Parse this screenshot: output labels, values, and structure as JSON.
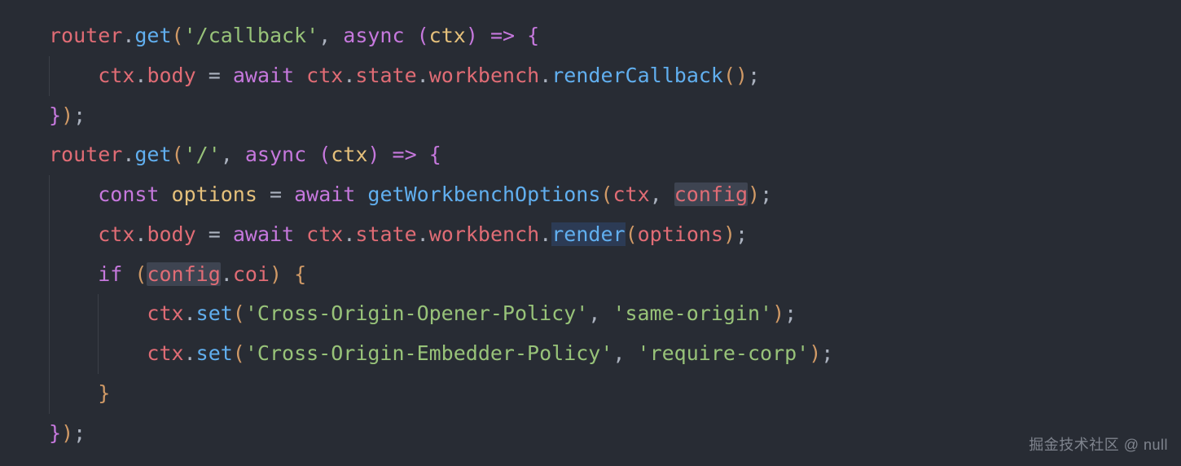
{
  "code": {
    "lines": [
      {
        "tokens": [
          {
            "t": "router",
            "c": "tok-var"
          },
          {
            "t": ".",
            "c": "tok-punct"
          },
          {
            "t": "get",
            "c": "tok-method"
          },
          {
            "t": "(",
            "c": "tok-paren"
          },
          {
            "t": "'/callback'",
            "c": "tok-string"
          },
          {
            "t": ", ",
            "c": "tok-punct"
          },
          {
            "t": "async",
            "c": "tok-keyword"
          },
          {
            "t": " ",
            "c": "tok-punct"
          },
          {
            "t": "(",
            "c": "tok-paren2"
          },
          {
            "t": "ctx",
            "c": "tok-param"
          },
          {
            "t": ")",
            "c": "tok-paren2"
          },
          {
            "t": " ",
            "c": "tok-punct"
          },
          {
            "t": "=>",
            "c": "tok-keyword"
          },
          {
            "t": " ",
            "c": "tok-punct"
          },
          {
            "t": "{",
            "c": "tok-brace2"
          }
        ],
        "indent": 0
      },
      {
        "tokens": [
          {
            "t": "    ",
            "c": "tok-punct"
          },
          {
            "t": "ctx",
            "c": "tok-var"
          },
          {
            "t": ".",
            "c": "tok-punct"
          },
          {
            "t": "body",
            "c": "tok-prop"
          },
          {
            "t": " ",
            "c": "tok-punct"
          },
          {
            "t": "=",
            "c": "tok-punct"
          },
          {
            "t": " ",
            "c": "tok-punct"
          },
          {
            "t": "await",
            "c": "tok-keyword"
          },
          {
            "t": " ",
            "c": "tok-punct"
          },
          {
            "t": "ctx",
            "c": "tok-var"
          },
          {
            "t": ".",
            "c": "tok-punct"
          },
          {
            "t": "state",
            "c": "tok-prop"
          },
          {
            "t": ".",
            "c": "tok-punct"
          },
          {
            "t": "workbench",
            "c": "tok-prop"
          },
          {
            "t": ".",
            "c": "tok-punct"
          },
          {
            "t": "renderCallback",
            "c": "tok-method"
          },
          {
            "t": "(",
            "c": "tok-paren"
          },
          {
            "t": ")",
            "c": "tok-paren"
          },
          {
            "t": ";",
            "c": "tok-punct"
          }
        ],
        "indent": 1
      },
      {
        "tokens": [
          {
            "t": "}",
            "c": "tok-brace2"
          },
          {
            "t": ")",
            "c": "tok-paren"
          },
          {
            "t": ";",
            "c": "tok-punct"
          }
        ],
        "indent": 0
      },
      {
        "tokens": [
          {
            "t": "router",
            "c": "tok-var"
          },
          {
            "t": ".",
            "c": "tok-punct"
          },
          {
            "t": "get",
            "c": "tok-method"
          },
          {
            "t": "(",
            "c": "tok-paren"
          },
          {
            "t": "'/'",
            "c": "tok-string"
          },
          {
            "t": ", ",
            "c": "tok-punct"
          },
          {
            "t": "async",
            "c": "tok-keyword"
          },
          {
            "t": " ",
            "c": "tok-punct"
          },
          {
            "t": "(",
            "c": "tok-paren2"
          },
          {
            "t": "ctx",
            "c": "tok-param"
          },
          {
            "t": ")",
            "c": "tok-paren2"
          },
          {
            "t": " ",
            "c": "tok-punct"
          },
          {
            "t": "=>",
            "c": "tok-keyword"
          },
          {
            "t": " ",
            "c": "tok-punct"
          },
          {
            "t": "{",
            "c": "tok-brace2"
          }
        ],
        "indent": 0
      },
      {
        "tokens": [
          {
            "t": "    ",
            "c": "tok-punct"
          },
          {
            "t": "const",
            "c": "tok-keyword"
          },
          {
            "t": " ",
            "c": "tok-punct"
          },
          {
            "t": "options",
            "c": "tok-const"
          },
          {
            "t": " ",
            "c": "tok-punct"
          },
          {
            "t": "=",
            "c": "tok-punct"
          },
          {
            "t": " ",
            "c": "tok-punct"
          },
          {
            "t": "await",
            "c": "tok-keyword"
          },
          {
            "t": " ",
            "c": "tok-punct"
          },
          {
            "t": "getWorkbenchOptions",
            "c": "tok-func"
          },
          {
            "t": "(",
            "c": "tok-paren"
          },
          {
            "t": "ctx",
            "c": "tok-var"
          },
          {
            "t": ", ",
            "c": "tok-punct"
          },
          {
            "t": "config",
            "c": "tok-var",
            "hl": "occ"
          },
          {
            "t": ")",
            "c": "tok-paren"
          },
          {
            "t": ";",
            "c": "tok-punct"
          }
        ],
        "indent": 1
      },
      {
        "tokens": [
          {
            "t": "    ",
            "c": "tok-punct"
          },
          {
            "t": "ctx",
            "c": "tok-var"
          },
          {
            "t": ".",
            "c": "tok-punct"
          },
          {
            "t": "body",
            "c": "tok-prop"
          },
          {
            "t": " ",
            "c": "tok-punct"
          },
          {
            "t": "=",
            "c": "tok-punct"
          },
          {
            "t": " ",
            "c": "tok-punct"
          },
          {
            "t": "await",
            "c": "tok-keyword"
          },
          {
            "t": " ",
            "c": "tok-punct"
          },
          {
            "t": "ctx",
            "c": "tok-var"
          },
          {
            "t": ".",
            "c": "tok-punct"
          },
          {
            "t": "state",
            "c": "tok-prop"
          },
          {
            "t": ".",
            "c": "tok-punct"
          },
          {
            "t": "workbench",
            "c": "tok-prop"
          },
          {
            "t": ".",
            "c": "tok-punct"
          },
          {
            "t": "render",
            "c": "tok-method",
            "hl": "sel"
          },
          {
            "t": "(",
            "c": "tok-paren"
          },
          {
            "t": "options",
            "c": "tok-var"
          },
          {
            "t": ")",
            "c": "tok-paren"
          },
          {
            "t": ";",
            "c": "tok-punct"
          }
        ],
        "indent": 1
      },
      {
        "tokens": [
          {
            "t": "    ",
            "c": "tok-punct"
          },
          {
            "t": "if",
            "c": "tok-keyword"
          },
          {
            "t": " ",
            "c": "tok-punct"
          },
          {
            "t": "(",
            "c": "tok-paren"
          },
          {
            "t": "config",
            "c": "tok-var",
            "hl": "occ"
          },
          {
            "t": ".",
            "c": "tok-punct"
          },
          {
            "t": "coi",
            "c": "tok-prop"
          },
          {
            "t": ")",
            "c": "tok-paren"
          },
          {
            "t": " ",
            "c": "tok-punct"
          },
          {
            "t": "{",
            "c": "tok-brace"
          }
        ],
        "indent": 1
      },
      {
        "tokens": [
          {
            "t": "        ",
            "c": "tok-punct"
          },
          {
            "t": "ctx",
            "c": "tok-var"
          },
          {
            "t": ".",
            "c": "tok-punct"
          },
          {
            "t": "set",
            "c": "tok-method"
          },
          {
            "t": "(",
            "c": "tok-paren"
          },
          {
            "t": "'Cross-Origin-Opener-Policy'",
            "c": "tok-string"
          },
          {
            "t": ", ",
            "c": "tok-punct"
          },
          {
            "t": "'same-origin'",
            "c": "tok-string"
          },
          {
            "t": ")",
            "c": "tok-paren"
          },
          {
            "t": ";",
            "c": "tok-punct"
          }
        ],
        "indent": 2
      },
      {
        "tokens": [
          {
            "t": "        ",
            "c": "tok-punct"
          },
          {
            "t": "ctx",
            "c": "tok-var"
          },
          {
            "t": ".",
            "c": "tok-punct"
          },
          {
            "t": "set",
            "c": "tok-method"
          },
          {
            "t": "(",
            "c": "tok-paren"
          },
          {
            "t": "'Cross-Origin-Embedder-Policy'",
            "c": "tok-string"
          },
          {
            "t": ", ",
            "c": "tok-punct"
          },
          {
            "t": "'require-corp'",
            "c": "tok-string"
          },
          {
            "t": ")",
            "c": "tok-paren"
          },
          {
            "t": ";",
            "c": "tok-punct"
          }
        ],
        "indent": 2
      },
      {
        "tokens": [
          {
            "t": "    ",
            "c": "tok-punct"
          },
          {
            "t": "}",
            "c": "tok-brace"
          }
        ],
        "indent": 1
      },
      {
        "tokens": [
          {
            "t": "}",
            "c": "tok-brace2"
          },
          {
            "t": ")",
            "c": "tok-paren"
          },
          {
            "t": ";",
            "c": "tok-punct"
          }
        ],
        "indent": 0
      }
    ]
  },
  "watermark": "掘金技术社区 @ null"
}
